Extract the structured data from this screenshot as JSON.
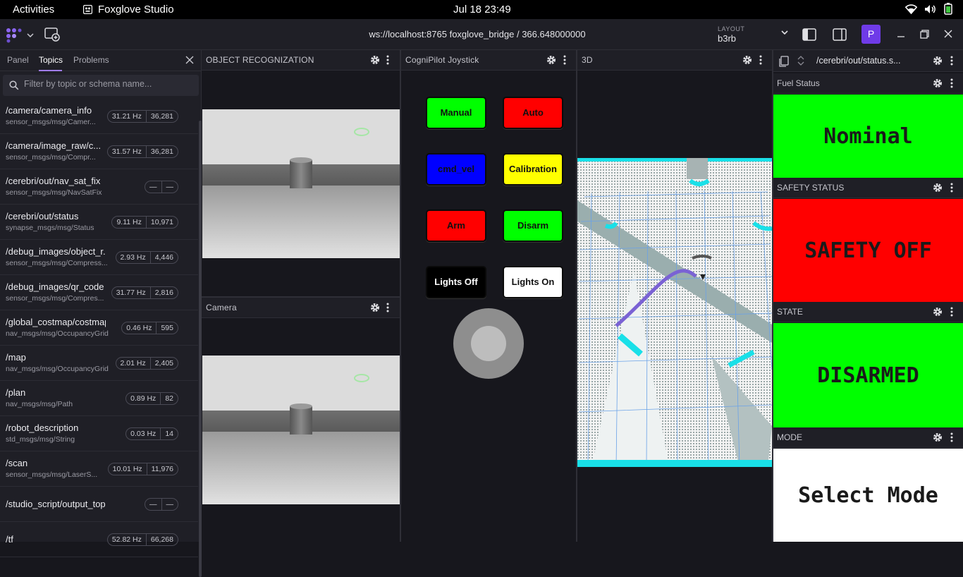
{
  "gnome": {
    "activities": "Activities",
    "app_name": "Foxglove Studio",
    "clock": "Jul 18  23:49"
  },
  "appbar": {
    "connection": "ws://localhost:8765 foxglove_bridge / 366.648000000",
    "layout_label": "LAYOUT",
    "layout_value": "b3rb",
    "user_initial": "P"
  },
  "sidebar": {
    "tabs": [
      "Panel",
      "Topics",
      "Problems"
    ],
    "active_tab": "Topics",
    "search_placeholder": "Filter by topic or schema name...",
    "topics": [
      {
        "name": "/camera/camera_info",
        "schema": "sensor_msgs/msg/Camer...",
        "hz": "31.21 Hz",
        "count": "36,281"
      },
      {
        "name": "/camera/image_raw/c...",
        "schema": "sensor_msgs/msg/Compr...",
        "hz": "31.57 Hz",
        "count": "36,281"
      },
      {
        "name": "/cerebri/out/nav_sat_fix",
        "schema": "sensor_msgs/msg/NavSatFix",
        "hz": "—",
        "count": "—"
      },
      {
        "name": "/cerebri/out/status",
        "schema": "synapse_msgs/msg/Status",
        "hz": "9.11 Hz",
        "count": "10,971"
      },
      {
        "name": "/debug_images/object_r...",
        "schema": "sensor_msgs/msg/Compress...",
        "hz": "2.93 Hz",
        "count": "4,446"
      },
      {
        "name": "/debug_images/qr_code",
        "schema": "sensor_msgs/msg/Compres...",
        "hz": "31.77 Hz",
        "count": "2,816"
      },
      {
        "name": "/global_costmap/costmap",
        "schema": "nav_msgs/msg/OccupancyGrid",
        "hz": "0.46 Hz",
        "count": "595"
      },
      {
        "name": "/map",
        "schema": "nav_msgs/msg/OccupancyGrid",
        "hz": "2.01 Hz",
        "count": "2,405"
      },
      {
        "name": "/plan",
        "schema": "nav_msgs/msg/Path",
        "hz": "0.89 Hz",
        "count": "82"
      },
      {
        "name": "/robot_description",
        "schema": "std_msgs/msg/String",
        "hz": "0.03 Hz",
        "count": "14"
      },
      {
        "name": "/scan",
        "schema": "sensor_msgs/msg/LaserS...",
        "hz": "10.01 Hz",
        "count": "11,976"
      },
      {
        "name": "/studio_script/output_topic",
        "schema": "",
        "hz": "—",
        "count": "—"
      },
      {
        "name": "/tf",
        "schema": "",
        "hz": "52.82 Hz",
        "count": "66,268"
      }
    ]
  },
  "panels": {
    "object_recognition": "OBJECT RECOGNIZATION",
    "camera": "Camera",
    "joystick": "CogniPilot Joystick",
    "three_d": "3D",
    "three_d_mode": "3D",
    "status_topic": "/cerebri/out/status.s..."
  },
  "joystick": {
    "buttons": [
      {
        "label": "Manual",
        "color": "#00ff00",
        "text": "#111111"
      },
      {
        "label": "Auto",
        "color": "#ff0000",
        "text": "#111111"
      },
      {
        "label": "cmd_vel",
        "color": "#0000ff",
        "text": "#111111"
      },
      {
        "label": "Calibration",
        "color": "#ffff00",
        "text": "#111111"
      },
      {
        "label": "Arm",
        "color": "#ff0000",
        "text": "#111111"
      },
      {
        "label": "Disarm",
        "color": "#00ff00",
        "text": "#111111"
      },
      {
        "label": "Lights Off",
        "color": "#000000",
        "text": "#ffffff"
      },
      {
        "label": "Lights On",
        "color": "#ffffff",
        "text": "#111111"
      }
    ]
  },
  "status_panels": [
    {
      "title": "Fuel Status",
      "value": "Nominal",
      "color": "#00ff00"
    },
    {
      "title": "SAFETY STATUS",
      "value": "SAFETY OFF",
      "color": "#ff0000"
    },
    {
      "title": "STATE",
      "value": "DISARMED",
      "color": "#00ff00"
    },
    {
      "title": "MODE",
      "value": "Select Mode",
      "color": "#ffffff"
    }
  ]
}
